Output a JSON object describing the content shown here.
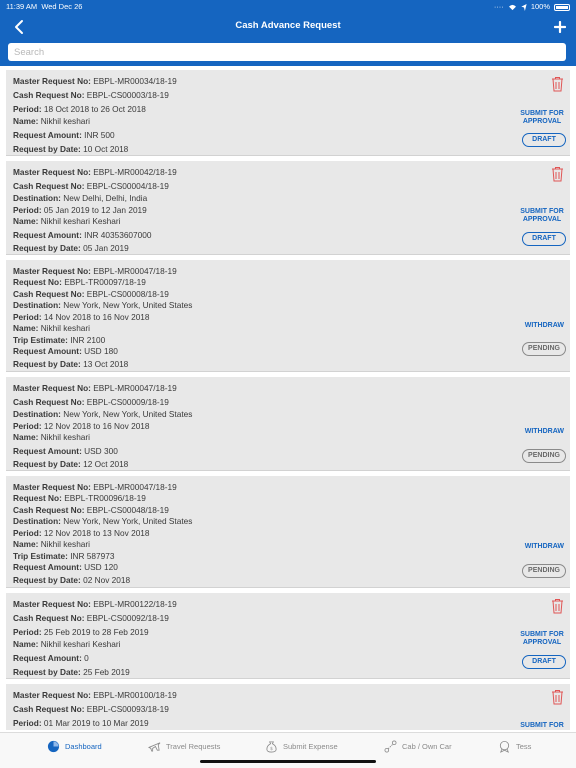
{
  "status_bar": {
    "time": "11:39 AM",
    "date": "Wed Dec 26",
    "battery": "100%"
  },
  "header": {
    "title": "Cash Advance Request"
  },
  "search": {
    "placeholder": "Search"
  },
  "labels": {
    "master": "Master Request No:",
    "cash": "Cash Request No:",
    "request": "Request No:",
    "destination": "Destination:",
    "period": "Period:",
    "name": "Name:",
    "trip": "Trip Estimate:",
    "amount": "Request Amount:",
    "bydate": "Request by Date:"
  },
  "actions": {
    "submit_line1": "SUBMIT FOR",
    "submit_line2": "APPROVAL",
    "withdraw": "WITHDRAW"
  },
  "cards": [
    {
      "master": "EBPL-MR00034/18-19",
      "cash": "EBPL-CS00003/18-19",
      "period": "18 Oct 2018 to 26 Oct 2018",
      "name": "Nikhil keshari",
      "amount": "INR  500",
      "bydate": "10 Oct 2018",
      "status": "DRAFT"
    },
    {
      "master": "EBPL-MR00042/18-19",
      "cash": "EBPL-CS00004/18-19",
      "destination": "New Delhi, Delhi, India",
      "period": "05 Jan 2019 to 12 Jan 2019",
      "name": "Nikhil keshari Keshari",
      "amount": "INR  40353607000",
      "bydate": "05 Jan 2019",
      "status": "DRAFT"
    },
    {
      "master": "EBPL-MR00047/18-19",
      "request": "EBPL-TR00097/18-19",
      "cash": "EBPL-CS00008/18-19",
      "destination": "New York, New York, United States",
      "period": "14 Nov 2018 to 16 Nov 2018",
      "name": "Nikhil keshari",
      "trip": "INR 2100",
      "amount": "USD  180",
      "bydate": "13 Oct 2018",
      "status": "PENDING"
    },
    {
      "master": "EBPL-MR00047/18-19",
      "cash": "EBPL-CS00009/18-19",
      "destination": "New York, New York, United States",
      "period": "12 Nov 2018 to 16 Nov 2018",
      "name": "Nikhil keshari",
      "amount": "USD  300",
      "bydate": "12 Oct 2018",
      "status": "PENDING"
    },
    {
      "master": "EBPL-MR00047/18-19",
      "request": "EBPL-TR00096/18-19",
      "cash": "EBPL-CS00048/18-19",
      "destination": "New York, New York, United States",
      "period": "12 Nov 2018 to 13 Nov 2018",
      "name": "Nikhil keshari",
      "trip": "INR 587973",
      "amount": "USD  120",
      "bydate": "02 Nov 2018",
      "status": "PENDING"
    },
    {
      "master": "EBPL-MR00122/18-19",
      "cash": "EBPL-CS00092/18-19",
      "period": "25 Feb 2019 to 28 Feb 2019",
      "name": "Nikhil keshari Keshari",
      "amount": "0",
      "bydate": "25 Feb 2019",
      "status": "DRAFT"
    },
    {
      "master": "EBPL-MR00100/18-19",
      "cash": "EBPL-CS00093/18-19",
      "period": "01 Mar 2019 to 10 Mar 2019"
    }
  ],
  "tabs": [
    {
      "label": "Dashboard",
      "icon": "dashboard-icon",
      "active": true
    },
    {
      "label": "Travel Requests",
      "icon": "plane-icon"
    },
    {
      "label": "Submit Expense",
      "icon": "money-bag-icon"
    },
    {
      "label": "Cab / Own Car",
      "icon": "cab-route-icon"
    },
    {
      "label": "Tess",
      "icon": "tess-icon"
    }
  ],
  "colors": {
    "primary": "#1565c0",
    "card_bg": "#e8e8e8",
    "trash": "#e05555",
    "pending_border": "#8a8a8a"
  }
}
